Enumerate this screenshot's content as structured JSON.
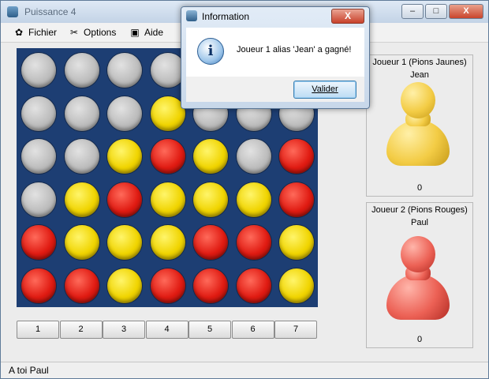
{
  "window": {
    "title": "Puissance 4",
    "controls": {
      "minimize": "–",
      "maximize": "□",
      "close": "X"
    }
  },
  "menu": [
    {
      "label": "Fichier",
      "icon": "puzzle-icon"
    },
    {
      "label": "Options",
      "icon": "tools-icon"
    },
    {
      "label": "Aide",
      "icon": "help-icon"
    }
  ],
  "board": {
    "rows": [
      [
        "empty",
        "empty",
        "empty",
        "empty",
        "empty",
        "empty",
        "empty"
      ],
      [
        "empty",
        "empty",
        "empty",
        "yellow",
        "empty",
        "empty",
        "empty"
      ],
      [
        "empty",
        "empty",
        "yellow",
        "red",
        "yellow",
        "empty",
        "red"
      ],
      [
        "empty",
        "yellow",
        "red",
        "yellow",
        "yellow",
        "yellow",
        "red"
      ],
      [
        "red",
        "yellow",
        "yellow",
        "yellow",
        "red",
        "red",
        "yellow"
      ],
      [
        "red",
        "red",
        "yellow",
        "red",
        "red",
        "red",
        "yellow"
      ]
    ],
    "colors": {
      "board": "#1d3e73",
      "yellow": "#f0d400",
      "red": "#e01b12",
      "empty": "#c0c0c0"
    }
  },
  "columns": [
    "1",
    "2",
    "3",
    "4",
    "5",
    "6",
    "7"
  ],
  "players": [
    {
      "title": "Joueur 1 (Pions Jaunes)",
      "name": "Jean",
      "score": "0",
      "color": "yellow"
    },
    {
      "title": "Joueur 2 (Pions Rouges)",
      "name": "Paul",
      "score": "0",
      "color": "red"
    }
  ],
  "status": "A toi Paul",
  "dialog": {
    "title": "Information",
    "close": "X",
    "message": "Joueur 1 alias 'Jean' a gagné!",
    "ok_label": "Valider",
    "icon": "info-icon"
  }
}
